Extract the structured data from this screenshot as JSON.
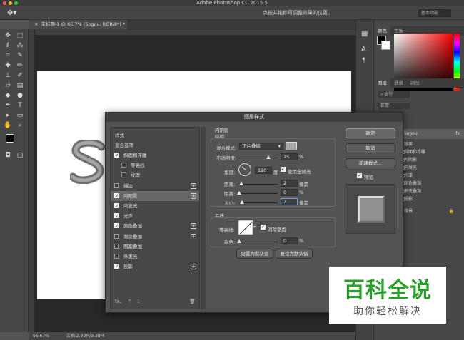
{
  "app": {
    "title": "Adobe Photoshop CC 2015.5",
    "hint": "点按并拖移可调整效果的位置。",
    "workspace": "基本功能",
    "doc_tab": "未标题-1 @ 66.7% (Sogou, RGB/8*) *",
    "zoom": "66.67%",
    "doc_size": "文档:2.93M/3.38M"
  },
  "panels": {
    "color_tabs": [
      "颜色",
      "色板"
    ],
    "layers_tabs": [
      "图层",
      "通道",
      "路径"
    ],
    "blend_mode": "正常",
    "layers": [
      {
        "name": "Sogou"
      },
      {
        "name": "效果"
      },
      {
        "name": "斜面和浮雕"
      },
      {
        "name": "内阴影"
      },
      {
        "name": "内发光"
      },
      {
        "name": "光泽"
      },
      {
        "name": "颜色叠加"
      },
      {
        "name": "渐变叠加"
      },
      {
        "name": "投影"
      },
      {
        "name": "背景"
      }
    ],
    "fx_label": "fx"
  },
  "dialog": {
    "title": "图层样式",
    "style_header": "样式",
    "blend_options": "混合选项",
    "styles": [
      {
        "label": "斜面和浮雕",
        "checked": true,
        "sub": false,
        "plus": false
      },
      {
        "label": "等高线",
        "checked": false,
        "sub": true,
        "plus": false
      },
      {
        "label": "纹理",
        "checked": false,
        "sub": true,
        "plus": false
      },
      {
        "label": "描边",
        "checked": false,
        "sub": false,
        "plus": true
      },
      {
        "label": "内阴影",
        "checked": true,
        "sub": false,
        "plus": true,
        "selected": true
      },
      {
        "label": "内发光",
        "checked": true,
        "sub": false,
        "plus": false
      },
      {
        "label": "光泽",
        "checked": true,
        "sub": false,
        "plus": false
      },
      {
        "label": "颜色叠加",
        "checked": true,
        "sub": false,
        "plus": true
      },
      {
        "label": "渐变叠加",
        "checked": false,
        "sub": false,
        "plus": true
      },
      {
        "label": "图案叠加",
        "checked": false,
        "sub": false,
        "plus": false
      },
      {
        "label": "外发光",
        "checked": false,
        "sub": false,
        "plus": false
      },
      {
        "label": "投影",
        "checked": true,
        "sub": false,
        "plus": true
      }
    ],
    "section_title": "内阴影",
    "structure_label": "结构",
    "blend_mode_label": "混合模式:",
    "blend_mode_value": "正片叠底",
    "opacity_label": "不透明度:",
    "opacity_value": "75",
    "percent": "%",
    "angle_label": "角度:",
    "angle_value": "120",
    "degree": "度",
    "global_light_label": "使用全局光",
    "global_light": true,
    "distance_label": "距离:",
    "distance_value": "2",
    "px": "像素",
    "choke_label": "阻塞:",
    "choke_value": "0",
    "size_label": "大小:",
    "size_value": "7",
    "quality_label": "品质",
    "contour_label": "等高线:",
    "antialias_label": "消除锯齿",
    "antialias": true,
    "noise_label": "杂色:",
    "noise_value": "0",
    "btn_set_default": "设置为默认值",
    "btn_reset_default": "复位为默认值",
    "btn_ok": "确定",
    "btn_cancel": "取消",
    "btn_new_style": "新建样式...",
    "preview_label": "预览",
    "preview": true,
    "fx_footer": "fx."
  },
  "brand": {
    "line1": "百科全说",
    "line2": "助你轻松解决",
    "color": "#2a9d2a"
  }
}
